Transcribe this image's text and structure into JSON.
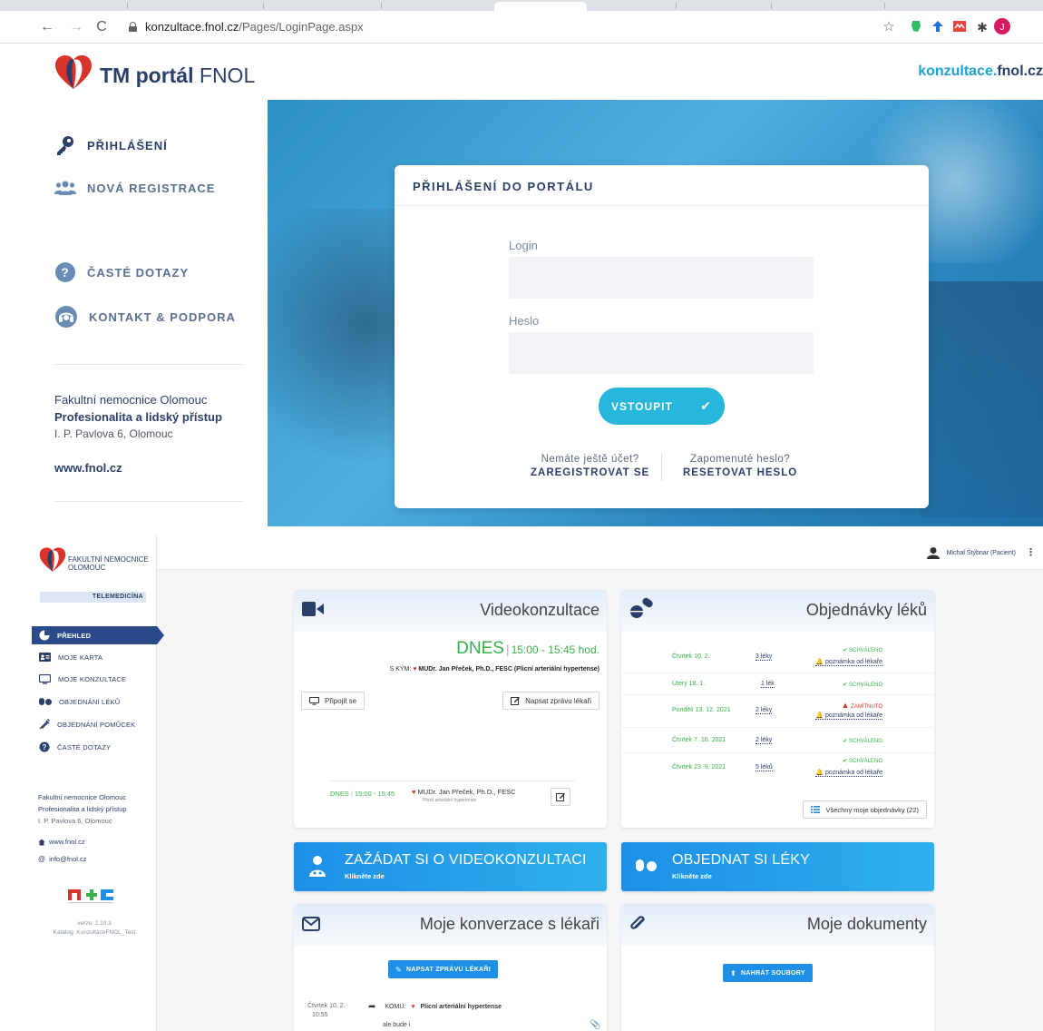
{
  "browser": {
    "url_host": "konzultace.fnol.cz",
    "url_path": "/Pages/LoginPage.aspx"
  },
  "portal": {
    "logo_bold": "TM portál",
    "logo_thin": "FNOL",
    "domain_part1": "konzultace.",
    "domain_part2": "fnol.cz",
    "menu": [
      {
        "label": "PŘIHLÁŠENÍ",
        "icon": "key-icon"
      },
      {
        "label": "NOVÁ REGISTRACE",
        "icon": "users-icon"
      },
      {
        "label": "ČASTÉ DOTAZY",
        "icon": "question-icon"
      },
      {
        "label": "KONTAKT & PODPORA",
        "icon": "headset-icon"
      }
    ],
    "address": {
      "name": "Fakultní nemocnice Olomouc",
      "motto": "Profesionalita a lidský přístup",
      "street": "I. P. Pavlova 6, Olomouc",
      "web": "www.fnol.cz"
    },
    "login": {
      "title": "PŘIHLÁŠENÍ DO PORTÁLU",
      "login_label": "Login",
      "password_label": "Heslo",
      "submit": "VSTOUPIT",
      "no_account_q": "Nemáte ještě účet?",
      "register": "ZAREGISTROVAT SE",
      "forgot_q": "Zapomenuté heslo?",
      "reset": "RESETOVAT HESLO"
    }
  },
  "dashboard": {
    "logo_line1": "FAKULTNÍ NEMOCNICE",
    "logo_line2": "OLOMOUC",
    "telemed": "TELEMEDICÍNA",
    "nav": [
      {
        "label": "PŘEHLED",
        "icon": "pie-chart-icon",
        "active": true
      },
      {
        "label": "MOJE KARTA",
        "icon": "id-card-icon",
        "active": false
      },
      {
        "label": "MOJE KONZULTACE",
        "icon": "monitor-icon",
        "active": false
      },
      {
        "label": "OBJEDNÁNÍ LÉKŮ",
        "icon": "pills-icon",
        "active": false
      },
      {
        "label": "OBJEDNÁNÍ POMŮCEK",
        "icon": "syringe-icon",
        "active": false
      },
      {
        "label": "ČASTÉ DOTAZY",
        "icon": "question-icon",
        "active": false
      }
    ],
    "sidebar_address": {
      "name": "Fakultní nemocnice Olomouc",
      "motto": "Profesionalita a lidský přístup",
      "street": "I. P. Pavlova 6, Olomouc",
      "web": "www.fnol.cz",
      "email": "info@fnol.cz"
    },
    "version": "verze: 2.10.3",
    "catalog": "Katalog: KonzultaceFNOL_Test",
    "user": "Michal Štýbnar (Pacient)",
    "video": {
      "title": "Videokonzultace",
      "today": "DNES",
      "time": "15:00 - 15:45 hod.",
      "with_prefix": "S KÝM:",
      "doctor": "MUDr. Jan Přeček, Ph.D., FESC (Plicní arteriální hypertense)",
      "connect": "Připojit se",
      "write_msg": "Napsat zprávu lékaři",
      "next_when": "DNES",
      "next_time": "15:00 - 15:45",
      "next_doctor": "MUDr. Jan Přeček, Ph.D., FESC",
      "next_sub": "Plicní arteriální hypertense"
    },
    "orders": {
      "title": "Objednávky léků",
      "rows": [
        {
          "date": "Čtvrtek 10. 2.",
          "count": "3 léky",
          "status": "SCHVÁLENO",
          "ok": true,
          "note": "poznámka od lékaře"
        },
        {
          "date": "Úterý 18. 1.",
          "count": "1 lék",
          "status": "SCHVÁLENO",
          "ok": true,
          "note": ""
        },
        {
          "date": "Pondělí 13. 12. 2021",
          "count": "2 léky",
          "status": "ZAMÍTNUTO",
          "ok": false,
          "note": "poznámka od lékaře"
        },
        {
          "date": "Čtvrtek 7. 10. 2021",
          "count": "2 léky",
          "status": "SCHVÁLENO",
          "ok": true,
          "note": ""
        },
        {
          "date": "Čtvrtek 23. 9. 2021",
          "count": "5 léků",
          "status": "SCHVÁLENO",
          "ok": true,
          "note": "poznámka od lékaře"
        }
      ],
      "all": "Všechny moje objednávky (22)"
    },
    "cta_video": {
      "title": "ZAŽÁDAT SI O VIDEOKONZULTACI",
      "sub": "Klikněte zde"
    },
    "cta_meds": {
      "title": "OBJEDNAT SI LÉKY",
      "sub": "Klikněte zde"
    },
    "conversations": {
      "title": "Moje konverzace s lékaři",
      "write": "NAPSAT ZPRÁVU LÉKAŘI",
      "date": "Čtvrtek 10. 2.",
      "time": "10:55",
      "to_prefix": "KOMU:",
      "to": "Plicní arteriální hypertense",
      "msg": "ale bude i"
    },
    "documents": {
      "title": "Moje dokumenty",
      "upload": "NAHRÁT SOUBORY"
    }
  },
  "colors": {
    "brand_navy": "#2a3f6a",
    "accent_cyan": "#27b7da",
    "success_green": "#36b34a",
    "danger_red": "#d9342b",
    "cta_blue": "#1d8fe6"
  }
}
